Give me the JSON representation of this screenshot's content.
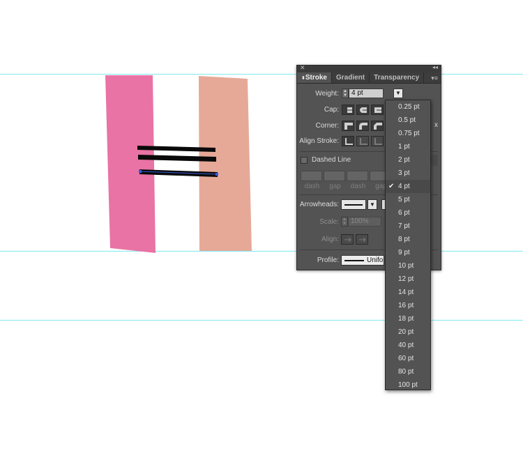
{
  "panel": {
    "tabs": [
      {
        "label": "Stroke"
      },
      {
        "label": "Gradient"
      },
      {
        "label": "Transparency"
      }
    ],
    "weight": {
      "label": "Weight:",
      "value": "4 pt"
    },
    "cap": {
      "label": "Cap:"
    },
    "corner": {
      "label": "Corner:",
      "limit_suffix": "x"
    },
    "align_stroke": {
      "label": "Align Stroke:"
    },
    "dashed_line": {
      "label": "Dashed Line",
      "checked": false
    },
    "dash_gap_labels": [
      "dash",
      "gap",
      "dash",
      "gap"
    ],
    "arrowheads": {
      "label": "Arrowheads:"
    },
    "scale": {
      "label": "Scale:",
      "value": "100%"
    },
    "align": {
      "label": "Align:"
    },
    "profile": {
      "label": "Profile:",
      "value": "Uniform"
    }
  },
  "weight_dropdown": {
    "options": [
      "0.25 pt",
      "0.5 pt",
      "0.75 pt",
      "1 pt",
      "2 pt",
      "3 pt",
      "4 pt",
      "5 pt",
      "6 pt",
      "7 pt",
      "8 pt",
      "9 pt",
      "10 pt",
      "12 pt",
      "14 pt",
      "16 pt",
      "18 pt",
      "20 pt",
      "40 pt",
      "60 pt",
      "80 pt",
      "100 pt"
    ],
    "selected": "4 pt"
  },
  "colors": {
    "guide": "#7fe9ef",
    "pink_shape": "#e873a4",
    "salmon_shape": "#e6a998",
    "selection": "#3a5bd9",
    "panel_bg": "#535353"
  }
}
